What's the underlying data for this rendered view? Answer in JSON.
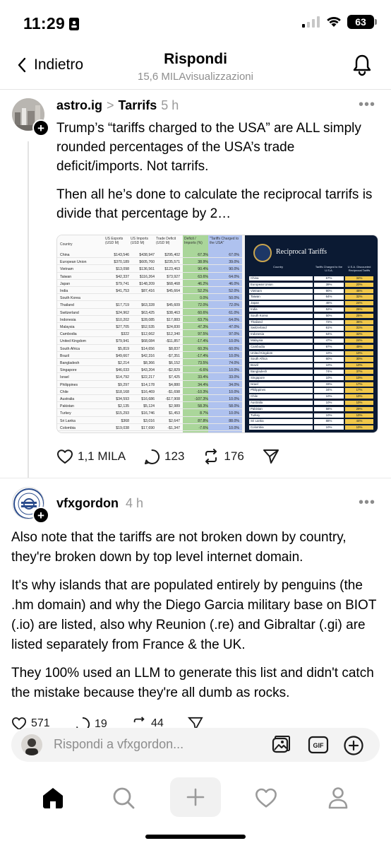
{
  "status_bar": {
    "time": "11:29",
    "battery": "63"
  },
  "header": {
    "back_label": "Indietro",
    "title": "Rispondi",
    "subtitle": "15,6 MILAvisualizzazioni"
  },
  "post1": {
    "username": "astro.ig",
    "separator": ">",
    "topic": "Tarrifs",
    "time": "5 h",
    "paragraphs": [
      "Trump’s “tariffs charged to the USA” are ALL simply rounded percentages of the USA’s trade deficit/imports. Not tarrifs.",
      "Then all he’s done to calculate the reciprocal tarrifs is divide that percentage by 2…"
    ],
    "image": {
      "table_headers": [
        "Country",
        "US Exports (USD M)",
        "US Imports (USD M)",
        "Trade Deficit (USD M)",
        "Deficit / Imports (%)",
        "\"Tariffs Charged to the USA\""
      ],
      "rows": [
        [
          "China",
          "$143,546",
          "$438,947",
          "$295,402",
          "67.3%",
          "67.0%"
        ],
        [
          "European Union",
          "$370,189",
          "$605,760",
          "$235,571",
          "38.9%",
          "39.0%"
        ],
        [
          "Vietnam",
          "$13,098",
          "$136,561",
          "$123,463",
          "90.4%",
          "90.0%"
        ],
        [
          "Taiwan",
          "$42,337",
          "$116,264",
          "$73,927",
          "63.6%",
          "64.0%"
        ],
        [
          "Japan",
          "$79,741",
          "$148,209",
          "$68,468",
          "46.2%",
          "46.0%"
        ],
        [
          "India",
          "$41,753",
          "$87,416",
          "$45,664",
          "52.2%",
          "52.0%"
        ],
        [
          "South Korea",
          "",
          "",
          "",
          "0.0%",
          "50.0%"
        ],
        [
          "Thailand",
          "$17,719",
          "$63,328",
          "$45,609",
          "72.0%",
          "72.0%"
        ],
        [
          "Switzerland",
          "$24,962",
          "$63,425",
          "$38,463",
          "60.6%",
          "61.0%"
        ],
        [
          "Indonesia",
          "$10,202",
          "$28,085",
          "$17,883",
          "63.7%",
          "64.0%"
        ],
        [
          "Malaysia",
          "$27,705",
          "$52,535",
          "$24,830",
          "47.3%",
          "47.0%"
        ],
        [
          "Cambodia",
          "$322",
          "$12,662",
          "$12,340",
          "97.5%",
          "97.0%"
        ],
        [
          "United Kingdom",
          "$79,941",
          "$68,084",
          "-$11,857",
          "-17.4%",
          "10.0%"
        ],
        [
          "South Africa",
          "$5,819",
          "$14,656",
          "$8,837",
          "60.3%",
          "60.0%"
        ],
        [
          "Brazil",
          "$49,667",
          "$42,316",
          "-$7,351",
          "-17.4%",
          "10.0%"
        ],
        [
          "Bangladesh",
          "$2,214",
          "$8,366",
          "$6,152",
          "73.5%",
          "74.0%"
        ],
        [
          "Singapore",
          "$46,033",
          "$43,204",
          "-$2,829",
          "-6.6%",
          "10.0%"
        ],
        [
          "Israel",
          "$14,792",
          "$22,217",
          "$7,425",
          "33.4%",
          "33.0%"
        ],
        [
          "Philippines",
          "$9,297",
          "$14,178",
          "$4,880",
          "34.4%",
          "34.0%"
        ],
        [
          "Chile",
          "$18,168",
          "$16,469",
          "-$1,698",
          "-10.3%",
          "10.0%"
        ],
        [
          "Australia",
          "$34,593",
          "$16,686",
          "-$17,908",
          "-107.3%",
          "10.0%"
        ],
        [
          "Pakistan",
          "$2,135",
          "$5,124",
          "$2,989",
          "58.3%",
          "58.0%"
        ],
        [
          "Turkey",
          "$15,293",
          "$16,746",
          "$1,453",
          "8.7%",
          "10.0%"
        ],
        [
          "Sri Lanka",
          "$368",
          "$3,016",
          "$2,647",
          "87.8%",
          "88.0%"
        ],
        [
          "Colombia",
          "$19,038",
          "$17,690",
          "-$1,347",
          "-7.6%",
          "10.0%"
        ]
      ],
      "rt_title": "Reciprocal Tariffs",
      "rt_headers": [
        "Country",
        "Tariffs Charged to the U.S.A.",
        "U.S.A. Discounted Reciprocal Tariffs"
      ],
      "rt_rows": [
        [
          "China",
          "67%",
          "34%"
        ],
        [
          "European Union",
          "39%",
          "20%"
        ],
        [
          "Vietnam",
          "90%",
          "46%"
        ],
        [
          "Taiwan",
          "64%",
          "32%"
        ],
        [
          "Japan",
          "46%",
          "24%"
        ],
        [
          "India",
          "52%",
          "26%"
        ],
        [
          "South Korea",
          "50%",
          "25%"
        ],
        [
          "Thailand",
          "72%",
          "36%"
        ],
        [
          "Switzerland",
          "61%",
          "31%"
        ],
        [
          "Indonesia",
          "64%",
          "32%"
        ],
        [
          "Malaysia",
          "47%",
          "24%"
        ],
        [
          "Cambodia",
          "97%",
          "49%"
        ],
        [
          "United Kingdom",
          "10%",
          "10%"
        ],
        [
          "South Africa",
          "60%",
          "30%"
        ],
        [
          "Brazil",
          "10%",
          "10%"
        ],
        [
          "Bangladesh",
          "74%",
          "37%"
        ],
        [
          "Singapore",
          "10%",
          "10%"
        ],
        [
          "Israel",
          "33%",
          "17%"
        ],
        [
          "Philippines",
          "34%",
          "17%"
        ],
        [
          "Chile",
          "10%",
          "10%"
        ],
        [
          "Australia",
          "10%",
          "10%"
        ],
        [
          "Pakistan",
          "58%",
          "29%"
        ],
        [
          "Turkey",
          "10%",
          "10%"
        ],
        [
          "Sri Lanka",
          "88%",
          "44%"
        ],
        [
          "Colombia",
          "10%",
          "10%"
        ]
      ]
    },
    "actions": {
      "likes": "1,1 MILA",
      "comments": "123",
      "reposts": "176"
    }
  },
  "post2": {
    "username": "vfxgordon",
    "time": "4 h",
    "paragraphs": [
      "Also note that the tariffs are not broken down by country, they're broken down by top level internet domain.",
      "It's why islands that are populated entirely by penguins (the .hm domain) and why the Diego Garcia military base on BIOT (.io) are listed, also why Reunion (.re) and Gibraltar (.gi) are listed separately from France & the UK.",
      "They 100% used an LLM to generate this list and didn't catch the mistake because they're all dumb as rocks."
    ],
    "actions": {
      "likes": "571",
      "comments": "19",
      "reposts": "44"
    }
  },
  "reply": {
    "placeholder": "Rispondi a vfxgordon..."
  },
  "colors": {
    "accent": "#000000",
    "muted": "#8e8e8e",
    "rt_bg": "#0b1a33",
    "rt_gold": "#f1c84b"
  },
  "tabs": [
    "home-icon",
    "search-icon",
    "plus-icon",
    "heart-icon",
    "profile-icon"
  ]
}
